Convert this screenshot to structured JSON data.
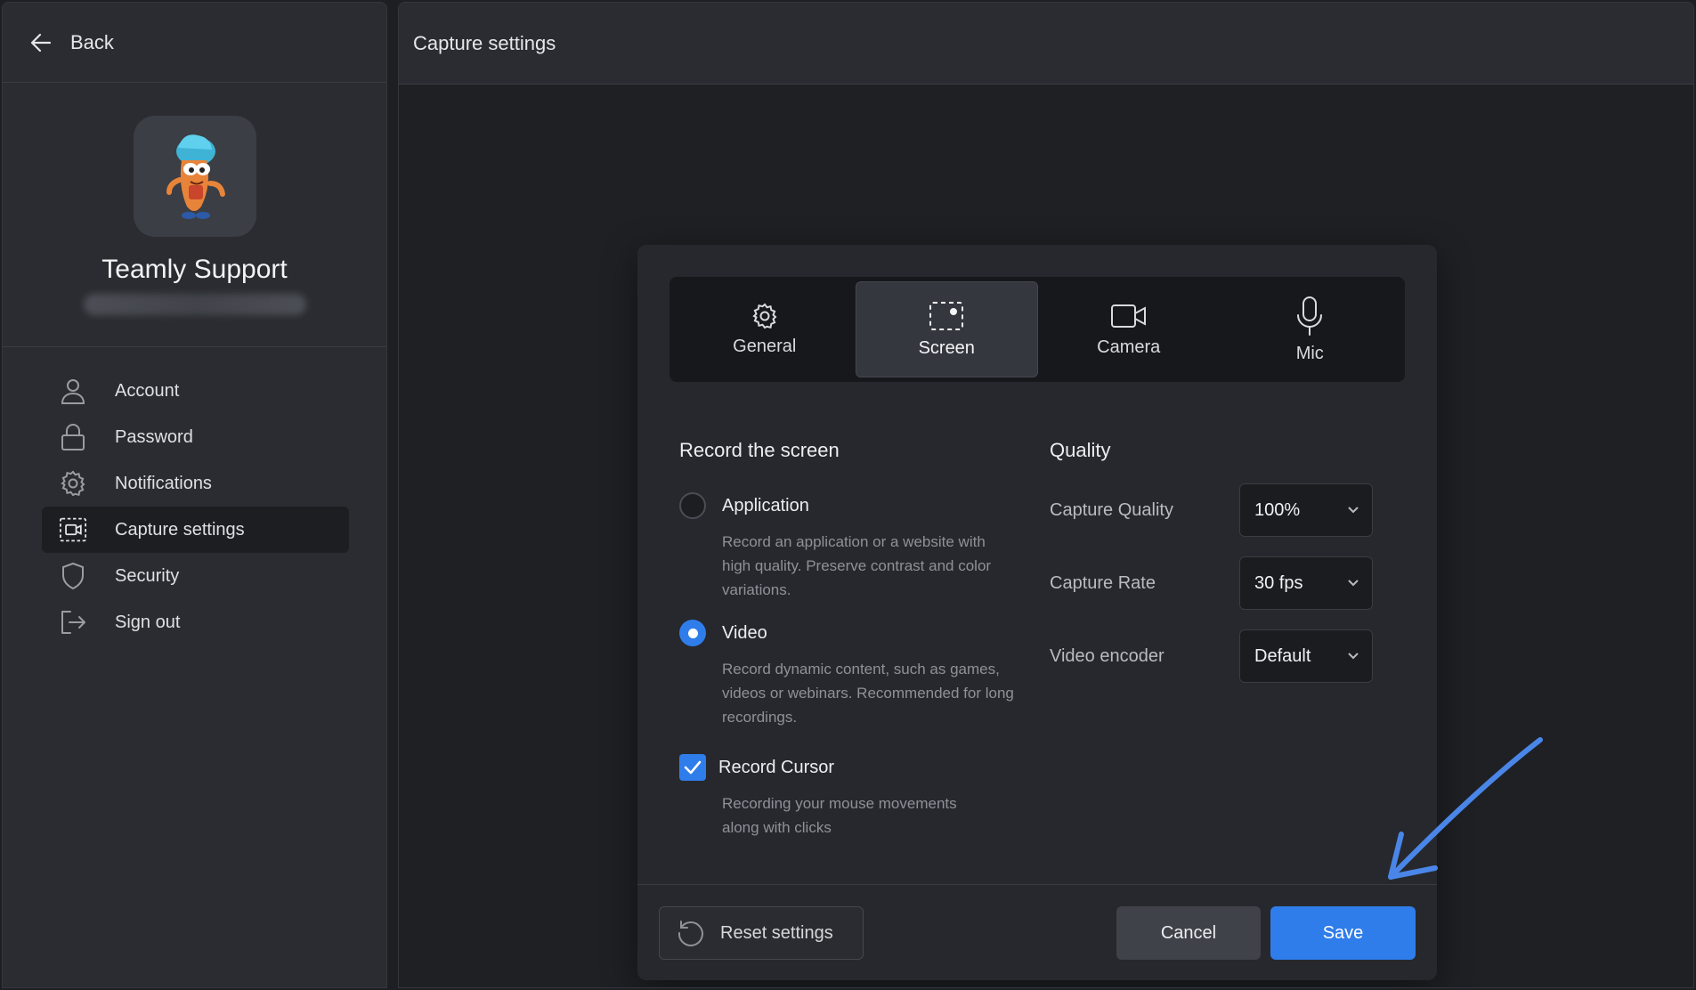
{
  "sidebar": {
    "back_label": "Back",
    "profile_name": "Teamly Support",
    "items": [
      {
        "label": "Account",
        "icon": "user-icon"
      },
      {
        "label": "Password",
        "icon": "lock-icon"
      },
      {
        "label": "Notifications",
        "icon": "gear-icon"
      },
      {
        "label": "Capture settings",
        "icon": "capture-icon",
        "active": true
      },
      {
        "label": "Security",
        "icon": "shield-icon"
      },
      {
        "label": "Sign out",
        "icon": "sign-out-icon"
      }
    ]
  },
  "main": {
    "title": "Capture settings"
  },
  "dialog": {
    "tabs": [
      {
        "label": "General",
        "icon": "gear-icon"
      },
      {
        "label": "Screen",
        "icon": "screen-capture-icon",
        "active": true
      },
      {
        "label": "Camera",
        "icon": "camera-icon"
      },
      {
        "label": "Mic",
        "icon": "microphone-icon"
      }
    ],
    "record": {
      "title": "Record the screen",
      "application": {
        "label": "Application",
        "description": "Record an application or a website with high quality. Preserve contrast and color variations.",
        "selected": false
      },
      "video": {
        "label": "Video",
        "description": "Record dynamic content, such as games, videos or webinars. Recommended for long recordings.",
        "selected": true
      },
      "cursor": {
        "label": "Record Cursor",
        "description": "Recording your mouse movements along with clicks",
        "checked": true
      }
    },
    "quality": {
      "title": "Quality",
      "capture_quality": {
        "label": "Capture Quality",
        "value": "100%"
      },
      "capture_rate": {
        "label": "Capture Rate",
        "value": "30 fps"
      },
      "video_encoder": {
        "label": "Video encoder",
        "value": "Default"
      }
    },
    "footer": {
      "reset_label": "Reset settings",
      "cancel_label": "Cancel",
      "save_label": "Save"
    }
  },
  "colors": {
    "accent": "#2f7dea",
    "annotation_arrow": "#4a86e8",
    "background": "#1e2024",
    "panel": "#2a2c31"
  }
}
